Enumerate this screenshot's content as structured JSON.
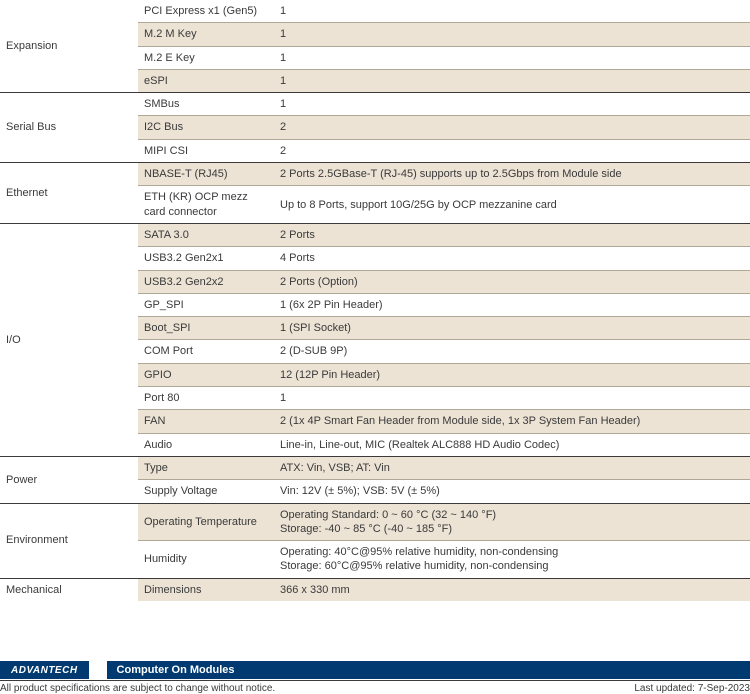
{
  "groups": [
    {
      "category": "Expansion",
      "rows": [
        {
          "sub": "PCI Express x1 (Gen5)",
          "val": "1",
          "alt": false
        },
        {
          "sub": "M.2 M Key",
          "val": "1",
          "alt": true
        },
        {
          "sub": "M.2 E Key",
          "val": "1",
          "alt": false
        },
        {
          "sub": "eSPI",
          "val": "1",
          "alt": true
        }
      ]
    },
    {
      "category": "Serial Bus",
      "rows": [
        {
          "sub": "SMBus",
          "val": "1",
          "alt": false
        },
        {
          "sub": "I2C Bus",
          "val": "2",
          "alt": true
        },
        {
          "sub": "MIPI CSI",
          "val": "2",
          "alt": false
        }
      ]
    },
    {
      "category": "Ethernet",
      "rows": [
        {
          "sub": "NBASE-T (RJ45)",
          "val": "2 Ports 2.5GBase-T (RJ-45) supports up to 2.5Gbps from Module side",
          "alt": true
        },
        {
          "sub": "ETH (KR) OCP mezz card connector",
          "val": "Up to 8 Ports, support 10G/25G by OCP mezzanine card",
          "alt": false
        }
      ]
    },
    {
      "category": "I/O",
      "rows": [
        {
          "sub": "SATA 3.0",
          "val": "2 Ports",
          "alt": true
        },
        {
          "sub": "USB3.2 Gen2x1",
          "val": "4 Ports",
          "alt": false
        },
        {
          "sub": "USB3.2 Gen2x2",
          "val": "2 Ports (Option)",
          "alt": true
        },
        {
          "sub": "GP_SPI",
          "val": "1 (6x 2P Pin Header)",
          "alt": false
        },
        {
          "sub": "Boot_SPI",
          "val": "1 (SPI Socket)",
          "alt": true
        },
        {
          "sub": "COM Port",
          "val": "2 (D-SUB 9P)",
          "alt": false
        },
        {
          "sub": "GPIO",
          "val": "12 (12P Pin Header)",
          "alt": true
        },
        {
          "sub": "Port 80",
          "val": "1",
          "alt": false
        },
        {
          "sub": "FAN",
          "val": "2 (1x 4P Smart Fan Header from Module side, 1x 3P System Fan Header)",
          "alt": true
        },
        {
          "sub": "Audio",
          "val": "Line-in, Line-out, MIC (Realtek ALC888 HD Audio Codec)",
          "alt": false
        }
      ]
    },
    {
      "category": "Power",
      "rows": [
        {
          "sub": "Type",
          "val": "ATX: Vin, VSB; AT: Vin",
          "alt": true
        },
        {
          "sub": "Supply Voltage",
          "val": "Vin: 12V (± 5%); VSB: 5V (± 5%)",
          "alt": false
        }
      ]
    },
    {
      "category": "Environment",
      "rows": [
        {
          "sub": "Operating Temperature",
          "val": "Operating Standard: 0 ~ 60 °C (32 ~ 140 °F)\nStorage: -40 ~ 85 °C (-40 ~ 185 °F)",
          "alt": true
        },
        {
          "sub": "Humidity",
          "val": "Operating: 40°C@95% relative humidity, non-condensing\nStorage: 60°C@95% relative humidity, non-condensing",
          "alt": false
        }
      ]
    },
    {
      "category": "Mechanical",
      "rows": [
        {
          "sub": "Dimensions",
          "val": "366 x 330 mm",
          "alt": true
        }
      ]
    }
  ],
  "footer": {
    "logo": "ADVANTECH",
    "title": "Computer On Modules",
    "disclaimer": "All product specifications are subject to change without notice.",
    "updated": "Last updated: 7-Sep-2023"
  }
}
